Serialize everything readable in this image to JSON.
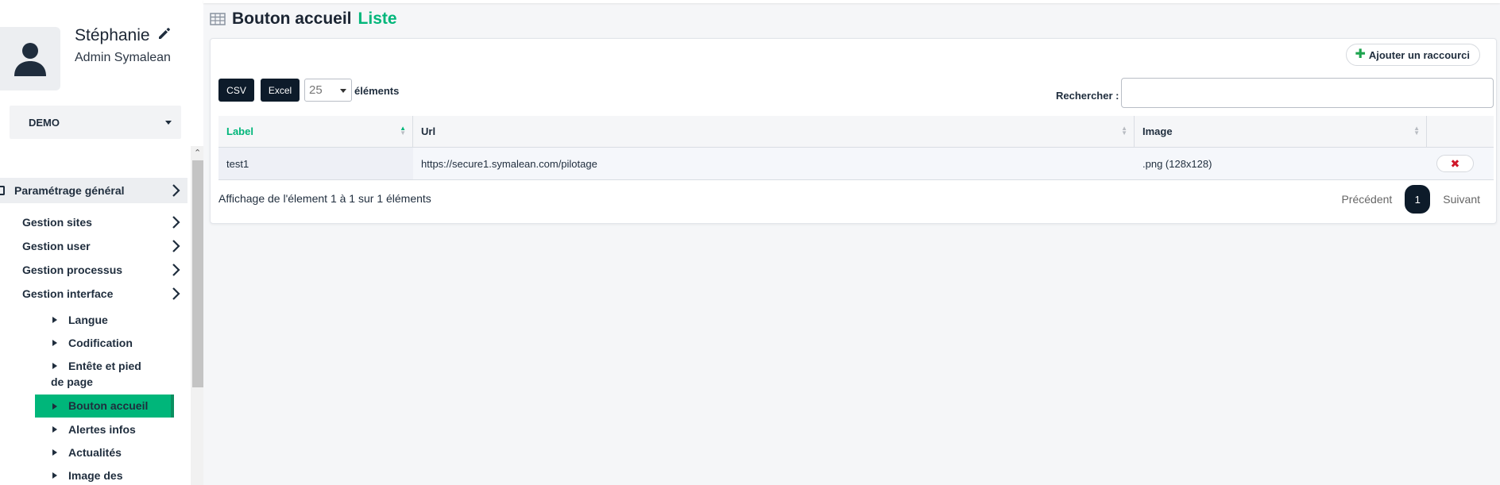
{
  "profile": {
    "name": "Stéphanie",
    "role": "Admin Symalean",
    "edit_icon": "pencil-icon",
    "avatar_icon": "user-icon"
  },
  "site_select": {
    "value": "DEMO"
  },
  "menu": {
    "section": {
      "label": "Paramétrage général"
    },
    "items": [
      {
        "label": "Gestion sites"
      },
      {
        "label": "Gestion user"
      },
      {
        "label": "Gestion processus"
      },
      {
        "label": "Gestion interface"
      }
    ],
    "subitems": [
      {
        "label": "Langue"
      },
      {
        "label": "Codification"
      },
      {
        "label": "Entête et pied de page"
      },
      {
        "label": "Bouton accueil",
        "active": true
      },
      {
        "label": "Alertes infos"
      },
      {
        "label": "Actualités"
      },
      {
        "label": "Image des"
      }
    ]
  },
  "page": {
    "title": "Bouton accueil",
    "title_accent": "Liste",
    "title_icon": "table-icon"
  },
  "toolbar": {
    "add_label": "Ajouter un raccourci",
    "csv_label": "CSV",
    "excel_label": "Excel",
    "page_length": "25",
    "length_label": "éléments",
    "search_label": "Rechercher :",
    "search_value": ""
  },
  "table": {
    "columns": [
      "Label",
      "Url",
      "Image",
      ""
    ],
    "rows": [
      {
        "label": "test1",
        "url": "https://secure1.symalean.com/pilotage",
        "image": ".png (128x128)"
      }
    ]
  },
  "footer": {
    "info": "Affichage de l'élement 1 à 1 sur 1 éléments",
    "prev_label": "Précédent",
    "current_page": "1",
    "next_label": "Suivant"
  },
  "colors": {
    "accent": "#00b67a",
    "dark": "#0d1b2a",
    "danger": "#d0182a"
  }
}
